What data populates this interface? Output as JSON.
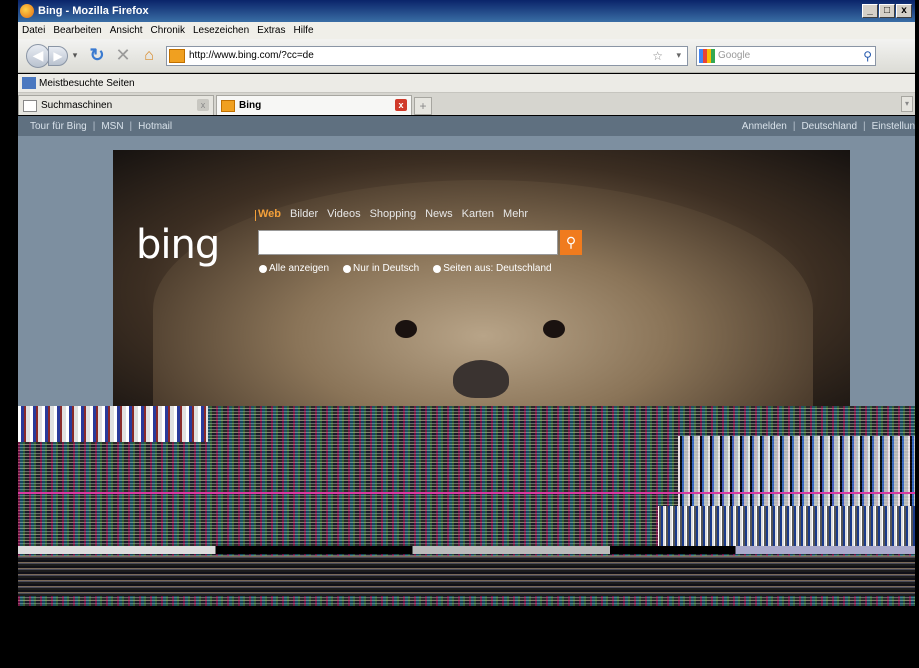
{
  "window": {
    "title": "Bing - Mozilla Firefox",
    "controls": [
      "_",
      "□",
      "x"
    ]
  },
  "menu": [
    "Datei",
    "Bearbeiten",
    "Ansicht",
    "Chronik",
    "Lesezeichen",
    "Extras",
    "Hilfe"
  ],
  "navbar": {
    "url": "http://www.bing.com/?cc=de",
    "search_placeholder": "Google"
  },
  "bookmarks": {
    "item": "Meistbesuchte Seiten"
  },
  "tabs": [
    {
      "label": "Suchmaschinen"
    },
    {
      "label": "Bing"
    }
  ],
  "page": {
    "topnav_left": [
      "Tour für Bing",
      "MSN",
      "Hotmail"
    ],
    "topnav_right": [
      "Anmelden",
      "Deutschland",
      "Einstellun"
    ],
    "logo": "bing",
    "verticals": [
      "Web",
      "Bilder",
      "Videos",
      "Shopping",
      "News",
      "Karten",
      "Mehr"
    ],
    "scopes": [
      "Alle anzeigen",
      "Nur in Deutsch",
      "Seiten aus: Deutschland"
    ],
    "selected_scope": "Alle anzeigen"
  }
}
